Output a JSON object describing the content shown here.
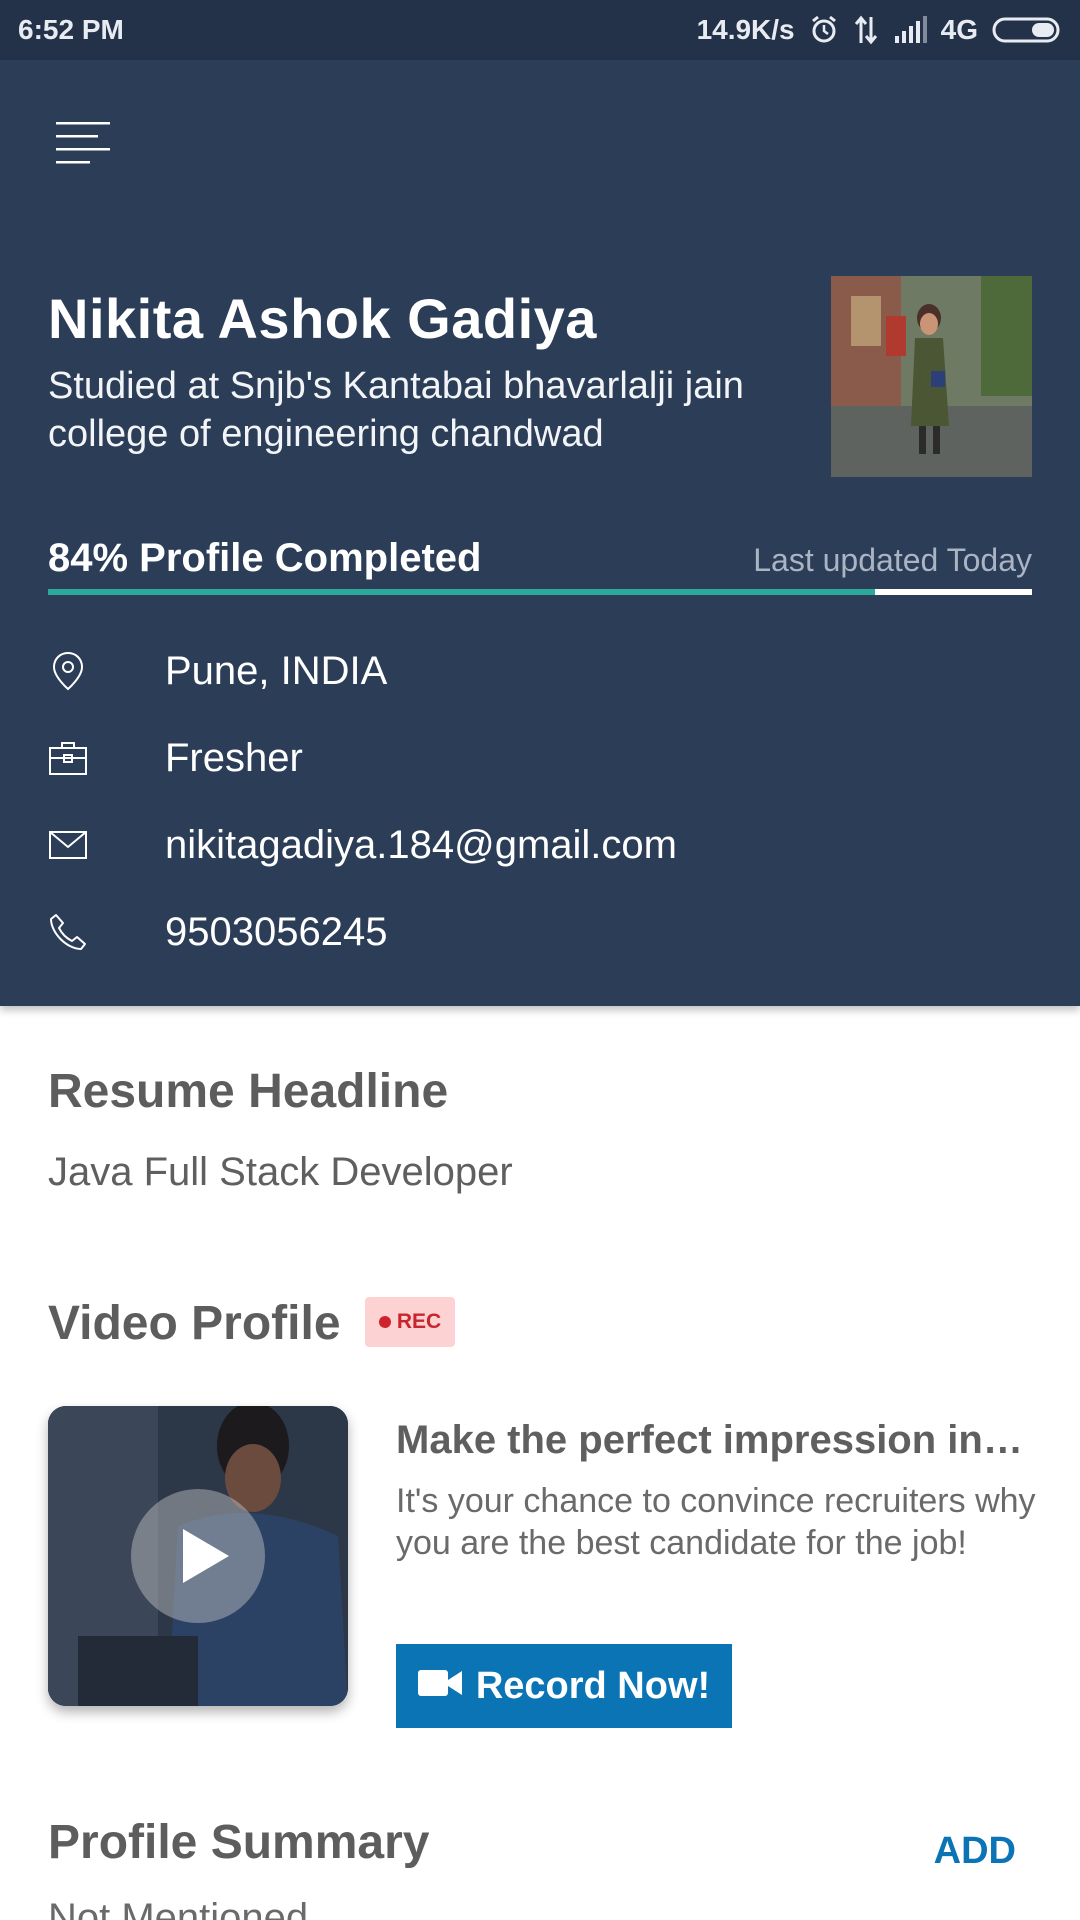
{
  "status_bar": {
    "time": "6:52 PM",
    "net_speed": "14.9K/s",
    "network": "4G",
    "icons": [
      "alarm-icon",
      "data-arrows-icon",
      "signal-icon",
      "battery-icon"
    ]
  },
  "header": {
    "menu_icon": "hamburger-menu-icon",
    "name": "Nikita Ashok Gadiya",
    "education": "Studied at Snjb's Kantabai bhavarlalji jain college of engineering chandwad",
    "progress": {
      "label": "84% Profile Completed",
      "percent": 84,
      "last_updated": "Last updated Today"
    },
    "info": [
      {
        "icon": "location-icon",
        "text": "Pune, INDIA"
      },
      {
        "icon": "briefcase-icon",
        "text": "Fresher"
      },
      {
        "icon": "mail-icon",
        "text": "nikitagadiya.184@gmail.com"
      },
      {
        "icon": "phone-icon",
        "text": "9503056245"
      }
    ]
  },
  "resume_headline": {
    "title": "Resume Headline",
    "value": "Java Full Stack Developer"
  },
  "video_profile": {
    "title": "Video Profile",
    "badge": "REC",
    "promo_title": "Make the perfect impression in…",
    "promo_body": "It's your chance to convince recruiters why you are the best candidate for the job!",
    "button_label": "Record Now!"
  },
  "profile_summary": {
    "title": "Profile Summary",
    "action": "ADD",
    "value": "Not Mentioned"
  },
  "colors": {
    "header_bg": "#2b3d57",
    "status_bg": "#233249",
    "accent": "#0a74b4",
    "progress": "#2ea89a",
    "rec_bg": "#fcd2d2"
  }
}
